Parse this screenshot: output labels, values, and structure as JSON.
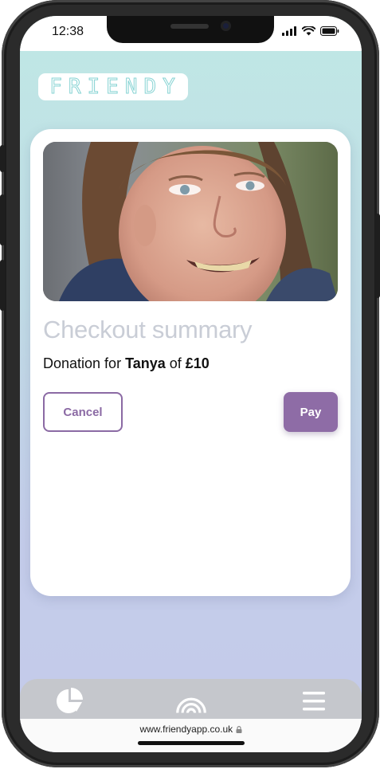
{
  "status": {
    "time": "12:38"
  },
  "brand": {
    "logo_text": "FRIENDY"
  },
  "checkout": {
    "title": "Checkout summary",
    "donation_prefix": "Donation for ",
    "recipient": "Tanya",
    "of_text": " of ",
    "amount": "£10",
    "cancel_label": "Cancel",
    "pay_label": "Pay"
  },
  "tabs": [
    {
      "icon": "pie-chart-icon"
    },
    {
      "icon": "rainbow-icon"
    },
    {
      "icon": "menu-icon"
    }
  ],
  "browser": {
    "url": "www.friendyapp.co.uk"
  },
  "colors": {
    "accent": "#8e6ca6",
    "background_top": "#bfe8e5",
    "background_bottom": "#c4caea",
    "title": "#c9cdd6"
  }
}
